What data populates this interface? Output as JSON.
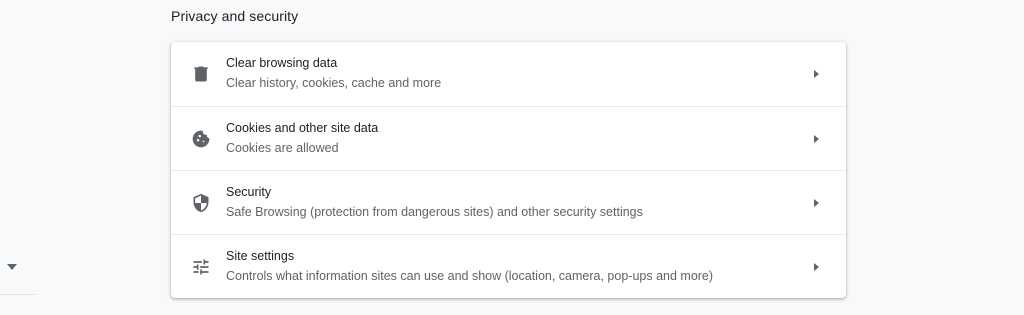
{
  "section": {
    "title": "Privacy and security"
  },
  "rows": [
    {
      "label": "Clear browsing data",
      "sublabel": "Clear history, cookies, cache and more",
      "icon": "trash-icon"
    },
    {
      "label": "Cookies and other site data",
      "sublabel": "Cookies are allowed",
      "icon": "cookie-icon"
    },
    {
      "label": "Security",
      "sublabel": "Safe Browsing (protection from dangerous sites) and other security settings",
      "icon": "shield-icon"
    },
    {
      "label": "Site settings",
      "sublabel": "Controls what information sites can use and show (location, camera, pop-ups and more)",
      "icon": "tune-icon"
    }
  ],
  "nav": {
    "chevron_icon": "chevron-down-icon"
  },
  "colors": {
    "background": "#f8f9fa",
    "card": "#ffffff",
    "primary_text": "#202124",
    "secondary_text": "#5f6368",
    "divider": "#e8eaed"
  }
}
